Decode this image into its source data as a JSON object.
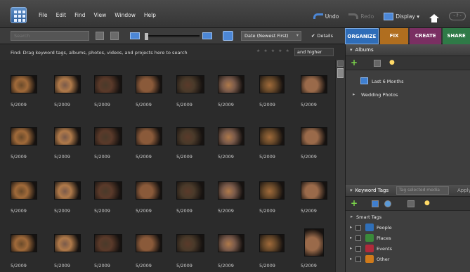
{
  "menubar": {
    "items": [
      "File",
      "Edit",
      "Find",
      "View",
      "Window",
      "Help"
    ],
    "undo": "Undo",
    "redo": "Redo",
    "display": "Display ▾",
    "help_btn": "- ? -"
  },
  "toolbar": {
    "search_placeholder": "Search",
    "sort": "Date (Newest First)",
    "details_label": "Details",
    "details_check": "✔"
  },
  "tabs": [
    {
      "label": "ORGANIZE",
      "color": "#2f6db8"
    },
    {
      "label": "FIX",
      "color": "#b06e1f"
    },
    {
      "label": "CREATE",
      "color": "#7a2f62"
    },
    {
      "label": "SHARE",
      "color": "#2f7a47"
    }
  ],
  "findbar": {
    "text": "Find: Drag keyword tags, albums, photos, videos, and projects here to search",
    "rating_filter": "and higher"
  },
  "photos": {
    "captions": [
      "5/2009",
      "5/2009",
      "5/2009",
      "5/2009",
      "5/2009",
      "5/2009",
      "5/2009",
      "5/2009",
      "5/2009",
      "5/2009",
      "5/2009",
      "5/2009",
      "5/2009",
      "5/2009",
      "5/2009",
      "5/2009",
      "5/2009",
      "5/2009",
      "5/2009",
      "5/2009",
      "5/2009",
      "5/2009",
      "5/2009",
      "5/2009",
      "5/2009",
      "5/2009",
      "5/2009",
      "5/2009",
      "5/2009",
      "5/2009",
      "5/2009",
      "5/2009"
    ]
  },
  "albums": {
    "title": "Albums",
    "items": [
      "Last 6 Months",
      "Wedding Photos"
    ]
  },
  "keywords": {
    "title": "Keyword Tags",
    "search_placeholder": "Tag selected media",
    "apply_label": "Apply",
    "tags": [
      {
        "label": "Smart Tags",
        "color": ""
      },
      {
        "label": "People",
        "color": "#2f6fb8"
      },
      {
        "label": "Places",
        "color": "#3a8a3a"
      },
      {
        "label": "Events",
        "color": "#b02a3a"
      },
      {
        "label": "Other",
        "color": "#d07a1a"
      }
    ]
  }
}
